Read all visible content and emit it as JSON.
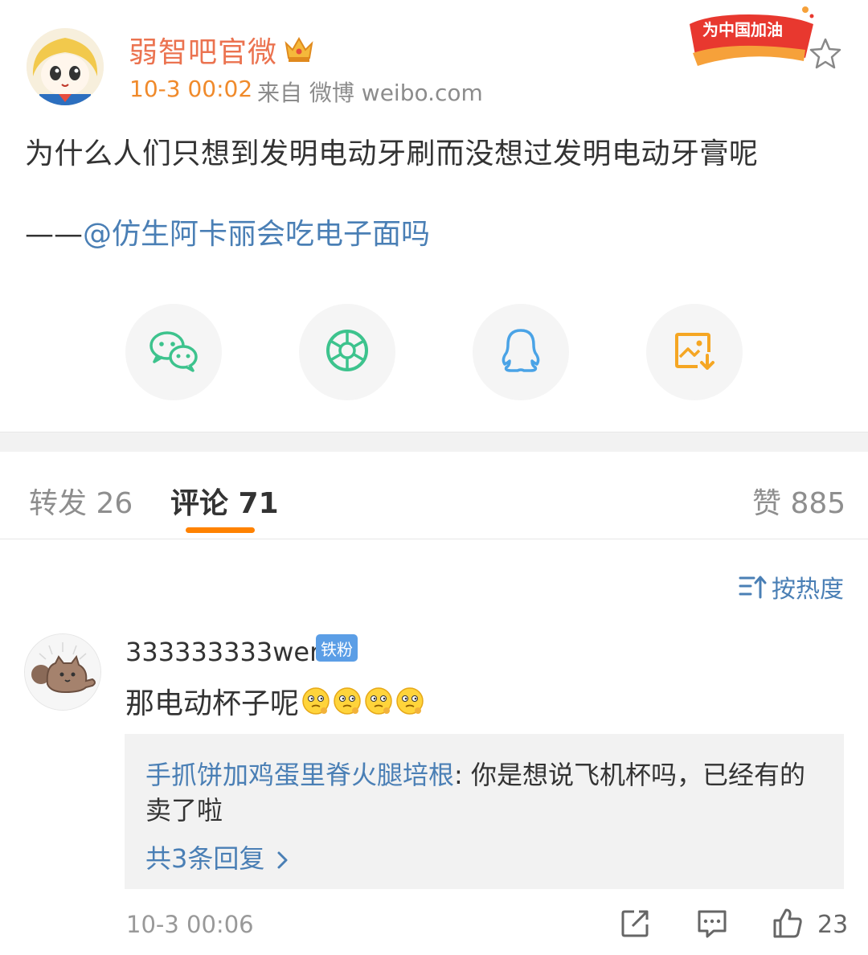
{
  "post": {
    "username": "弱智吧官微",
    "time": "10-3 00:02",
    "source": "来自 微博 weibo.com",
    "badge_text": "为中国加油",
    "content": "为什么人们只想到发明电动牙刷而没想过发明电动牙膏呢",
    "credit_dash": "——",
    "credit_mention": "@仿生阿卡丽会吃电子面吗"
  },
  "share": {
    "icons": [
      "wechat-icon",
      "moments-icon",
      "qq-icon",
      "save-image-icon"
    ]
  },
  "tabs": {
    "repost": "转发 26",
    "comment": "评论 71",
    "like": "赞 885"
  },
  "sort": {
    "label": "按热度"
  },
  "comment": {
    "username": "333333333wer",
    "fan_badge": "铁粉",
    "text": "那电动杯子呢",
    "emoji_count": 4,
    "reply_user": "手抓饼加鸡蛋里脊火腿培根",
    "reply_sep": ": ",
    "reply_text_1": "你是想说飞机杯吗，已经有的",
    "reply_text_2": "卖了啦",
    "reply_more": "共3条回复",
    "time": "10-3 00:06",
    "likes": "23"
  },
  "colors": {
    "brand_orange": "#ff8200",
    "username_orange": "#eb7350",
    "link_blue": "#4a7fb5",
    "wechat_green": "#3dc38d",
    "moments_green": "#3dc38d",
    "qq_blue": "#4aa3e6",
    "save_orange": "#f5a623"
  }
}
